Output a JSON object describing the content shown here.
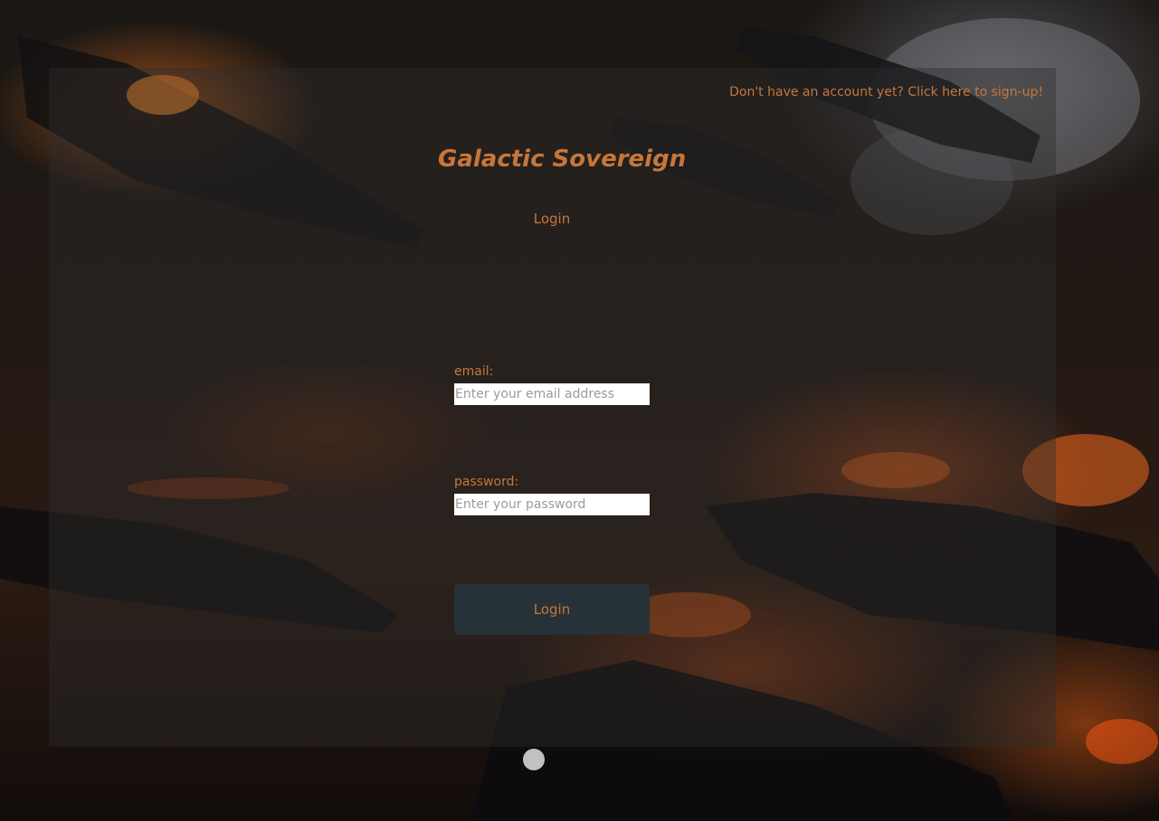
{
  "header": {
    "signup_link": "Don't have an account yet? Click here to sign-up!"
  },
  "app": {
    "title": "Galactic Sovereign"
  },
  "form": {
    "heading": "Login",
    "email_label": "email:",
    "email_placeholder": "Enter your email address",
    "email_value": "",
    "password_label": "password:",
    "password_placeholder": "Enter your password",
    "password_value": "",
    "submit_label": "Login"
  },
  "theme": {
    "accent_color": "#c7763a",
    "button_color": "#263238",
    "background_image": "space battle with burning starships"
  }
}
